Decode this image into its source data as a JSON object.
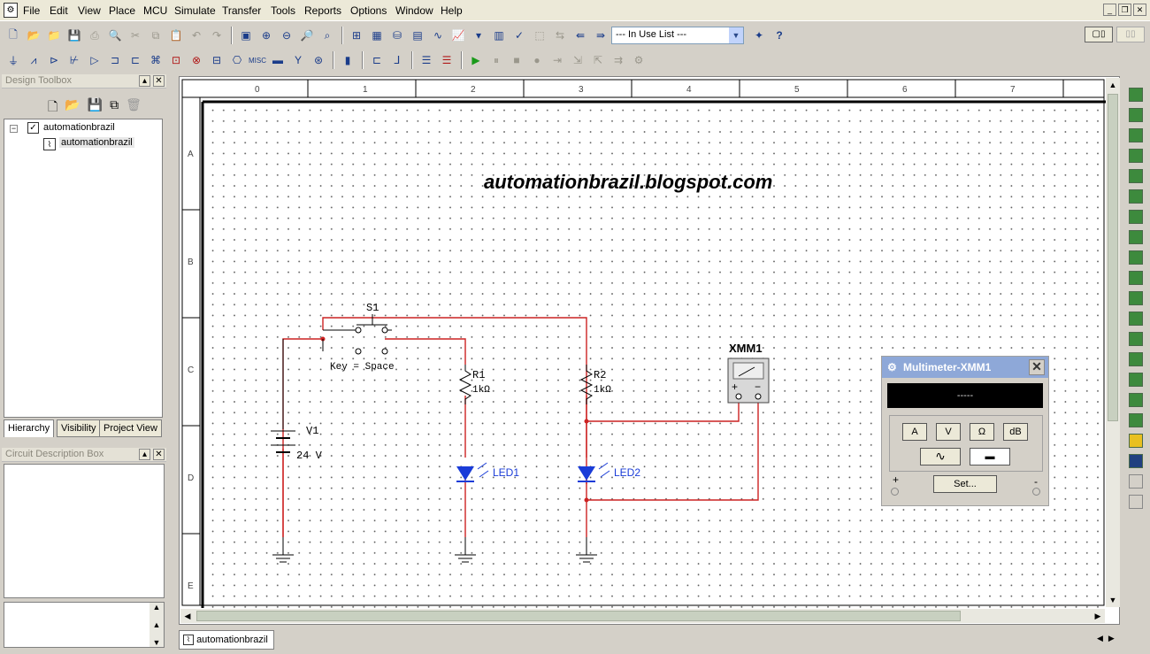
{
  "menu": {
    "items": [
      "File",
      "Edit",
      "View",
      "Place",
      "MCU",
      "Simulate",
      "Transfer",
      "Tools",
      "Reports",
      "Options",
      "Window",
      "Help"
    ]
  },
  "toolbar": {
    "in_use_list": "--- In Use List ---"
  },
  "design_toolbox": {
    "title": "Design Toolbox",
    "tree_root": "automationbrazil",
    "tree_child": "automationbrazil",
    "tabs": [
      "Hierarchy",
      "Visibility",
      "Project View"
    ]
  },
  "circuit_description": {
    "title": "Circuit Description Box"
  },
  "ruler": {
    "columns": [
      "0",
      "1",
      "2",
      "3",
      "4",
      "5",
      "6",
      "7"
    ],
    "rows": [
      "A",
      "B",
      "C",
      "D",
      "E"
    ]
  },
  "schematic": {
    "watermark_title": "automationbrazil.blogspot.com",
    "switch_label": "S1",
    "switch_key": "Key = Space",
    "source_label": "V1",
    "source_value": "24 V",
    "r1_label": "R1",
    "r1_value": "1kΩ",
    "r2_label": "R2",
    "r2_value": "1kΩ",
    "led1_label": "LED1",
    "led2_label": "LED2",
    "meter_label": "XMM1",
    "meter_plus": "+",
    "meter_minus": "−",
    "wire_color": "#cc2222",
    "led_color": "#1a3cd8"
  },
  "multimeter": {
    "title": "Multimeter-XMM1",
    "display": "-----",
    "buttons": [
      "A",
      "V",
      "Ω",
      "dB"
    ],
    "settings_label": "Set...",
    "plus": "+",
    "minus": "-"
  },
  "sheet_tab": "automationbrazil"
}
